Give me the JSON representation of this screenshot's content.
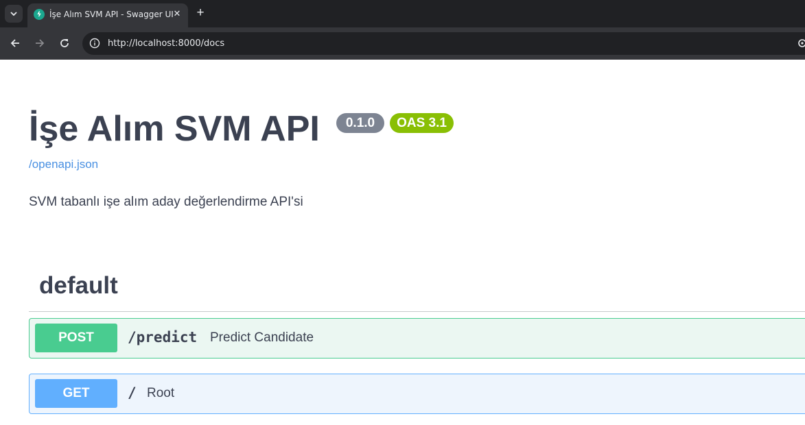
{
  "browser": {
    "tab_title": "İşe Alım SVM API - Swagger UI",
    "url": "http://localhost:8000/docs",
    "new_tab_label": "+",
    "close_label": "✕"
  },
  "info": {
    "title": "İşe Alım SVM API",
    "version": "0.1.0",
    "oas_version": "OAS 3.1",
    "spec_link": "/openapi.json",
    "description": "SVM tabanlı işe alım aday değerlendirme API'si"
  },
  "section": {
    "name": "default"
  },
  "operations": [
    {
      "method": "POST",
      "path": "/predict",
      "summary": "Predict Candidate"
    },
    {
      "method": "GET",
      "path": "/",
      "summary": "Root"
    }
  ],
  "colors": {
    "post": "#49cc90",
    "get": "#61affe",
    "link": "#4990e2",
    "text": "#3b4151",
    "version_badge": "#7d8492",
    "oas_badge": "#89bf04"
  },
  "icons": {
    "tab_menu": "chevron-down-icon",
    "favicon": "fastapi-logo-icon",
    "back": "arrow-left-icon",
    "forward": "arrow-right-icon",
    "reload": "reload-icon",
    "site_info": "info-icon"
  }
}
